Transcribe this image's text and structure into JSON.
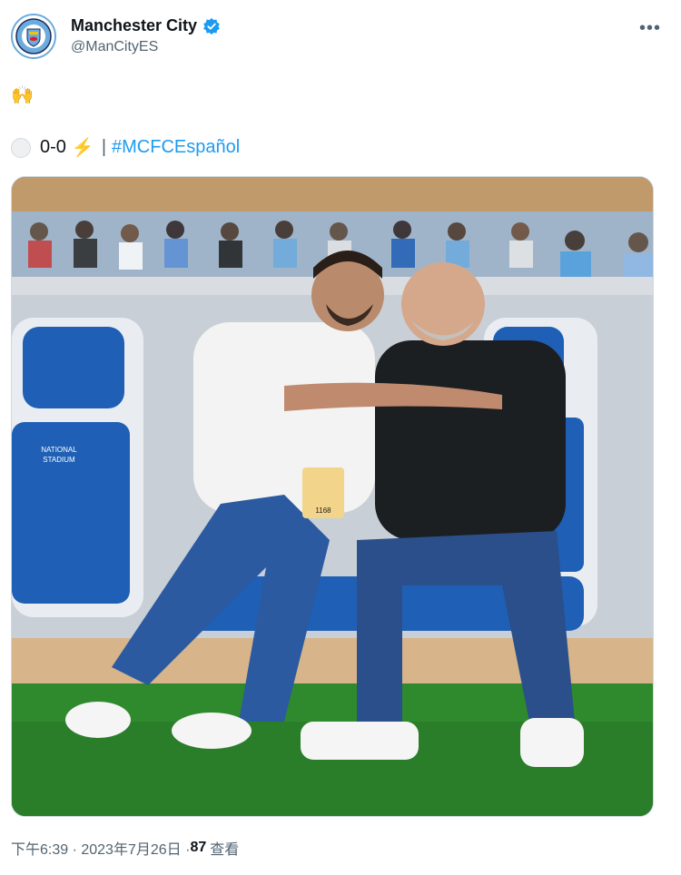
{
  "account": {
    "display_name": "Manchester City",
    "handle": "@ManCityES",
    "verified": true,
    "avatar_icon": "man-city-crest-icon"
  },
  "header": {
    "more_label": "•••"
  },
  "tweet": {
    "emoji_line": "🙌",
    "score": "0-0",
    "bolt": "⚡",
    "separator": "|",
    "hashtag": "#MCFCEspañol"
  },
  "photo": {
    "stadium_seat_text": "NATIONAL STADIUM",
    "badge_number": "1168"
  },
  "footer": {
    "time": "下午6:39 · 2023年7月26日 · ",
    "views_count": "87",
    "views_label": "查看"
  },
  "colors": {
    "accent": "#1d9bf0",
    "city_blue": "#6cabdd",
    "grass": "#2f8a2e",
    "seat_blue": "#1f5fb5"
  }
}
